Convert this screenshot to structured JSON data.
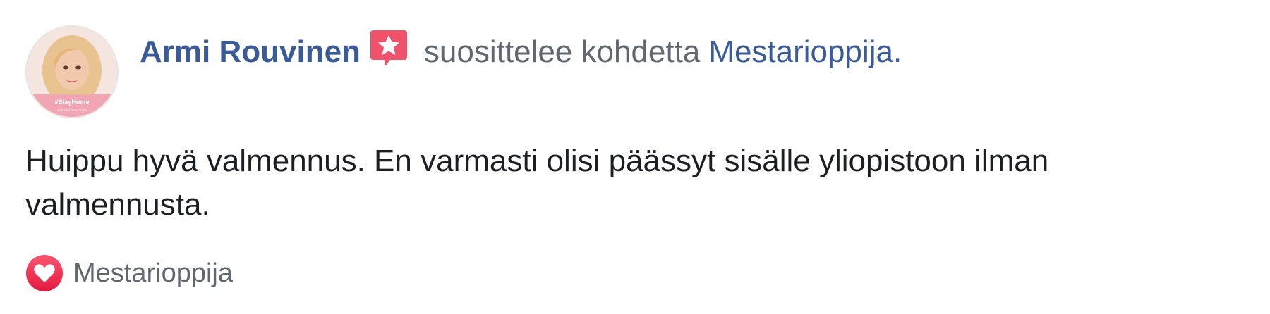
{
  "recommendation": {
    "author_name": "Armi Rouvinen",
    "verb_text": "suosittelee kohdetta",
    "page_name": "Mestarioppija",
    "punctuation": ".",
    "avatar_banner": "#StayHome",
    "avatar_banner_sub": "YOU CAN SAVE LIVES",
    "review_text": "Huippu hyvä valmennus. En varmasti olisi päässyt sisälle yliopistoon ilman valmennusta.",
    "footer_page_name": "Mestarioppija"
  },
  "icons": {
    "recommend": "star-speech-bubble-icon",
    "reaction": "heart-icon"
  },
  "colors": {
    "link_blue": "#3b5b98",
    "muted_gray": "#606770",
    "text_dark": "#1c1e21",
    "recommend_red": "#f0526b",
    "heart_red": "#f0284a"
  }
}
